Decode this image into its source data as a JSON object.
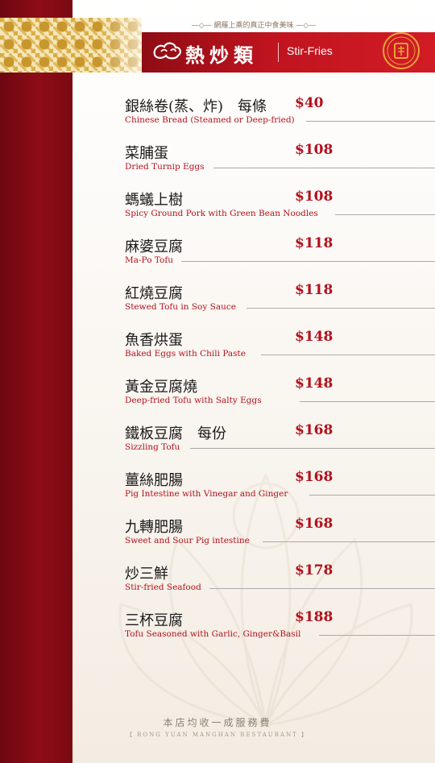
{
  "header": {
    "tagline": "—◇— 網羅上乘的真正中食美味 —◇—",
    "title_zh": "熱炒類",
    "title_en": "Stir-Fries"
  },
  "items": [
    {
      "zh": "銀絲卷(蒸、炸)　每條",
      "en": "Chinese Bread (Steamed or Deep-fried)",
      "price": "$40"
    },
    {
      "zh": "菜脯蛋",
      "en": "Dried Turnip Eggs",
      "price": "$108"
    },
    {
      "zh": "螞蟻上樹",
      "en": "Spicy Ground Pork with Green Bean Noodles",
      "price": "$108"
    },
    {
      "zh": "麻婆豆腐",
      "en": "Ma-Po Tofu",
      "price": "$118"
    },
    {
      "zh": "紅燒豆腐",
      "en": "Stewed Tofu in Soy Sauce",
      "price": "$118"
    },
    {
      "zh": "魚香烘蛋",
      "en": "Baked Eggs with Chili Paste",
      "price": "$148"
    },
    {
      "zh": "黃金豆腐燒",
      "en": "Deep-fried Tofu with Salty Eggs",
      "price": "$148"
    },
    {
      "zh": "鐵板豆腐　每份",
      "en": "Sizzling Tofu",
      "price": "$168"
    },
    {
      "zh": "薑絲肥腸",
      "en": "Pig Intestine with Vinegar and Ginger",
      "price": "$168"
    },
    {
      "zh": "九轉肥腸",
      "en": "Sweet and Sour Pig intestine",
      "price": "$168"
    },
    {
      "zh": "炒三鮮",
      "en": "Stir-fried Seafood",
      "price": "$178"
    },
    {
      "zh": "三杯豆腐",
      "en": "Tofu Seasoned with Garlic, Ginger&Basil",
      "price": "$188"
    }
  ],
  "footer": {
    "note_zh": "本店均收一成服務費",
    "restaurant_en": "【 RONG YUAN MANGHAN RESTAURANT 】"
  }
}
